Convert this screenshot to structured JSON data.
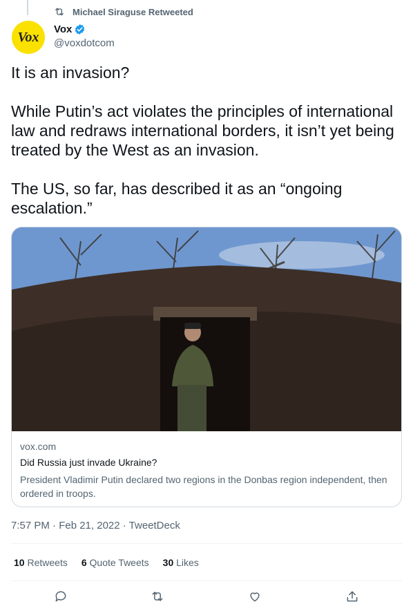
{
  "retweet_context": {
    "text": "Michael Siraguse Retweeted"
  },
  "author": {
    "avatar_text": "Vox",
    "name": "Vox",
    "handle": "@voxdotcom",
    "avatar_color": "#fae100",
    "verified_color": "#1d9bf0"
  },
  "tweet": {
    "text": "It is an invasion?\n\nWhile Putin’s act violates the principles of international law and redraws international borders, it isn’t yet being treated by the West as an invasion.\n\nThe US, so far, has described it as an “ongoing escalation.”"
  },
  "card": {
    "domain": "vox.com",
    "title": "Did Russia just invade Ukraine?",
    "description": "President Vladimir Putin declared two regions in the Donbas region independent, then ordered in troops."
  },
  "meta": {
    "timestamp": "7:57 PM · Feb 21, 2022 · TweetDeck"
  },
  "stats": [
    {
      "count": "10",
      "label": "Retweets"
    },
    {
      "count": "6",
      "label": "Quote Tweets"
    },
    {
      "count": "30",
      "label": "Likes"
    }
  ],
  "actions": [
    {
      "icon": "reply-icon"
    },
    {
      "icon": "retweet-icon"
    },
    {
      "icon": "like-icon"
    },
    {
      "icon": "share-icon"
    }
  ]
}
